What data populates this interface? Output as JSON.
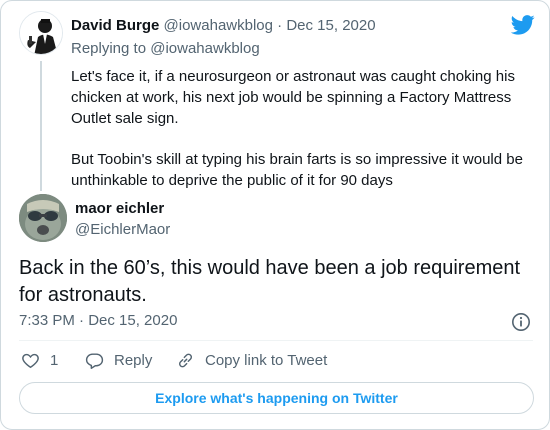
{
  "parent_tweet": {
    "display_name": "David Burge",
    "handle": "@iowahawkblog",
    "separator": "·",
    "date": "Dec 15, 2020",
    "replying_label": "Replying to",
    "replying_handle": "@iowahawkblog",
    "paragraphs": [
      "Let's face it, if a neurosurgeon or astronaut was caught choking his chicken at work, his next job would be spinning a Factory Mattress Outlet sale sign.",
      "But Toobin's skill at typing his brain farts is so impressive it would be unthinkable to deprive the public of it for 90 days"
    ]
  },
  "main_tweet": {
    "display_name": "maor eichler",
    "handle": "@EichlerMaor",
    "text": "Back in the 60’s, this would have been a job requirement for astronauts.",
    "timestamp": "7:33 PM · Dec 15, 2020"
  },
  "actions": {
    "like_count": "1",
    "reply_label": "Reply",
    "copy_link_label": "Copy link to Tweet"
  },
  "explore_label": "Explore what's happening on Twitter",
  "icons": {
    "brand": "twitter-bird-icon",
    "info": "info-icon",
    "like": "heart-icon",
    "reply": "reply-bubble-icon",
    "copy": "link-icon"
  },
  "colors": {
    "brand_blue": "#1d9bf0",
    "text_primary": "#0f1419",
    "text_secondary": "#536471",
    "border": "#cfd9de"
  }
}
